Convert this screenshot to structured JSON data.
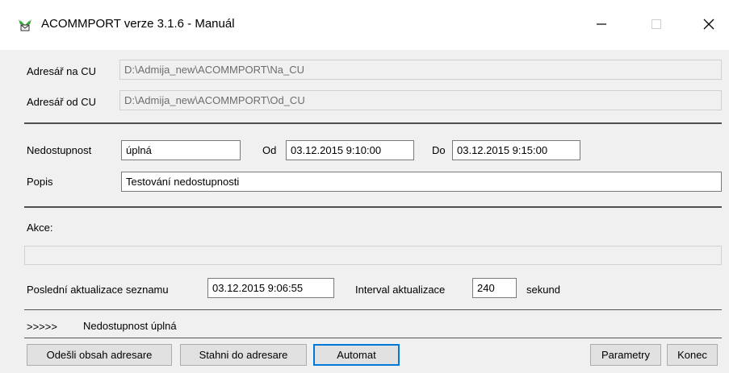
{
  "window": {
    "title": "ACOMMPORT verze 3.1.6 - Manuál",
    "icons": {
      "app": "app-logo-icon",
      "minimize": "minimize-icon",
      "maximize": "maximize-icon",
      "close": "close-icon"
    }
  },
  "directories": {
    "to_cu_label": "Adresář na CU",
    "to_cu_value": "D:\\Admija_new\\ACOMMPORT\\Na_CU",
    "from_cu_label": "Adresář od CU",
    "from_cu_value": "D:\\Admija_new\\ACOMMPORT\\Od_CU"
  },
  "outage": {
    "label": "Nedostupnost",
    "value": "úplná",
    "from_label": "Od",
    "from_value": "03.12.2015 9:10:00",
    "to_label": "Do",
    "to_value": "03.12.2015 9:15:00",
    "description_label": "Popis",
    "description_value": "Testování nedostupnosti"
  },
  "actions": {
    "label": "Akce:",
    "value": ""
  },
  "update": {
    "last_update_label": "Poslední aktualizace seznamu",
    "last_update_value": "03.12.2015 9:06:55",
    "interval_label": "Interval aktualizace",
    "interval_value": "240",
    "unit_label": "sekund"
  },
  "status": {
    "prefix": ">>>>>",
    "text": "Nedostupnost úplná"
  },
  "buttons": {
    "send": "Odešli obsah adresare",
    "download": "Stahni do adresare",
    "automat": "Automat",
    "params": "Parametry",
    "end": "Konec"
  },
  "colors": {
    "background": "#f0f0f0",
    "titlebar": "#ffffff",
    "default_button_border": "#0078d7",
    "icon_green": "#2e9b2e"
  }
}
